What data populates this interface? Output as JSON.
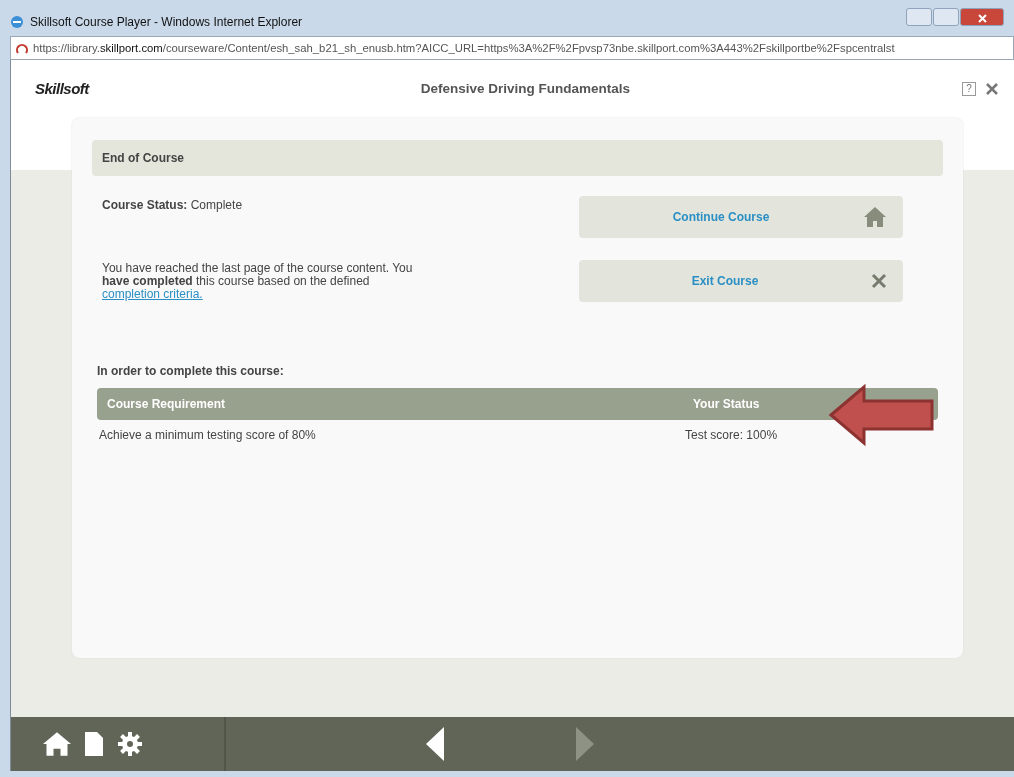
{
  "window": {
    "title": "Skillsoft Course Player - Windows Internet Explorer"
  },
  "address_bar": {
    "prefix": "https://library.",
    "domain": "skillport.com",
    "rest": "/courseware/Content/esh_sah_b21_sh_enusb.htm?AICC_URL=https%3A%2F%2Fpvsp73nbe.skillport.com%3A443%2Fskillportbe%2Fspcentralst"
  },
  "header": {
    "logo": "Skillsoft",
    "title": "Defensive Driving Fundamentals",
    "help": "?"
  },
  "section": {
    "title": "End of Course"
  },
  "status": {
    "label": "Course Status:",
    "value": "Complete"
  },
  "message": {
    "text": "You have reached the last page of the course content. You **have completed** this course based on the defined",
    "link": "completion criteria."
  },
  "actions": [
    {
      "label": "Continue Course",
      "kind": "home"
    },
    {
      "label": "Exit Course",
      "kind": "close"
    }
  ],
  "requirements": {
    "title": "In order to complete this course:",
    "columns": [
      "Course Requirement",
      "Your Status"
    ],
    "rows": [
      [
        "Achieve a minimum testing score of 80%",
        "Test score: 100%"
      ]
    ]
  },
  "toolbar": {
    "tools": [
      {
        "kind": "home"
      },
      {
        "kind": "page"
      },
      {
        "kind": "settings"
      }
    ],
    "nav": [
      {
        "kind": "back",
        "disabled": false
      },
      {
        "kind": "next",
        "disabled": true
      }
    ]
  }
}
